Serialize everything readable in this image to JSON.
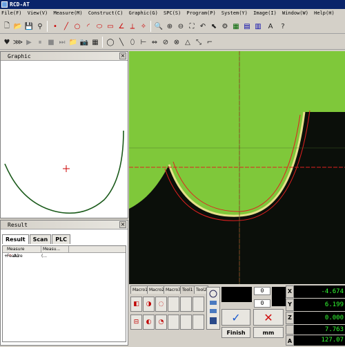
{
  "app": {
    "title": "RCD-AT"
  },
  "menu": [
    "File(F)",
    "View(V)",
    "Measure(M)",
    "Construct(C)",
    "Graphic(G)",
    "SPC(S)",
    "Program(P)",
    "System(Y)",
    "Image(I)",
    "Window(W)",
    "Help(H)"
  ],
  "graphic_panel": {
    "title": "Graphic",
    "close": "×"
  },
  "result_panel": {
    "title": "Result",
    "close": "×",
    "tabs": [
      "Result",
      "Scan",
      "PLC"
    ],
    "columns": [
      "Measure Feature",
      "Measu..."
    ],
    "rows": [
      {
        "feature": "A1",
        "value": "(..."
      }
    ]
  },
  "macro_tabs": [
    "Macro1",
    "Macro2",
    "Macro3",
    "Tool1",
    "Tool2"
  ],
  "spinners": [
    "0",
    "0"
  ],
  "buttons": {
    "finish": "Finish",
    "unit": "mm",
    "ok_glyph": "✓",
    "cancel_glyph": "✕"
  },
  "dro": [
    {
      "axis": "X",
      "value": "-4.674"
    },
    {
      "axis": "Y",
      "value": "6.199"
    },
    {
      "axis": "Z",
      "value": "0.000"
    },
    {
      "axis": "",
      "value": "7.763"
    },
    {
      "axis": "A",
      "value": "127.07"
    }
  ],
  "colors": {
    "title_bar": "#0a246a",
    "camera_background": "#7fc83a",
    "part_shadow": "#0b0f0a",
    "crosshair": "#e02020",
    "fit_curve": "#1a5a1a",
    "dro_text": "#33ff33"
  }
}
